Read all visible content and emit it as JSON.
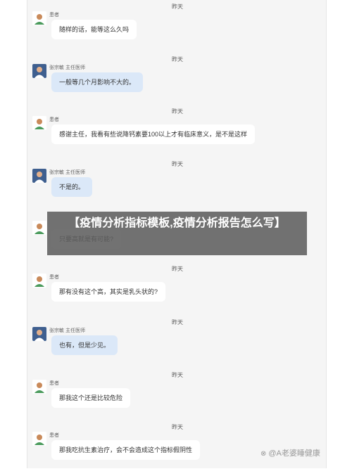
{
  "chat": {
    "messages": [
      {
        "time": "昨天",
        "sender": "患者",
        "title": "",
        "role": "patient",
        "text": "随样的话，能等这么久吗"
      },
      {
        "time": "昨天",
        "sender": "张宗敏",
        "title": "主任医师",
        "role": "doctor",
        "text": "一般等几个月影响不大的。"
      },
      {
        "time": "昨天",
        "sender": "患者",
        "title": "",
        "role": "patient",
        "text": "感谢主任，我看有些说降钙素要100以上才有临床意义，是不是这样"
      },
      {
        "time": "昨天",
        "sender": "张宗敏",
        "title": "主任医师",
        "role": "doctor",
        "text": "不是的。"
      },
      {
        "time": "",
        "sender": "",
        "title": "",
        "role": "patient",
        "text": "只要高就是有可能?"
      },
      {
        "time": "昨天",
        "sender": "患者",
        "title": "",
        "role": "patient",
        "text": "那有没有这个高，其实是乳头状的?"
      },
      {
        "time": "昨天",
        "sender": "张宗敏",
        "title": "主任医师",
        "role": "doctor",
        "text": "也有，但是少见。"
      },
      {
        "time": "昨天",
        "sender": "患者",
        "title": "",
        "role": "patient",
        "text": "那我这个还是比较危险"
      },
      {
        "time": "昨天",
        "sender": "患者",
        "title": "",
        "role": "patient",
        "text": "那我吃抗生素治疗，会不会造成这个指标假阴性"
      }
    ]
  },
  "overlay": {
    "title": "【疫情分析指标模板,疫情分析报告怎么写】"
  },
  "watermark": {
    "text": "@A老婆睡健康"
  },
  "colors": {
    "doctor_bubble": "#dbe8f8",
    "patient_bubble": "#ffffff",
    "background": "#f5f5f5"
  }
}
